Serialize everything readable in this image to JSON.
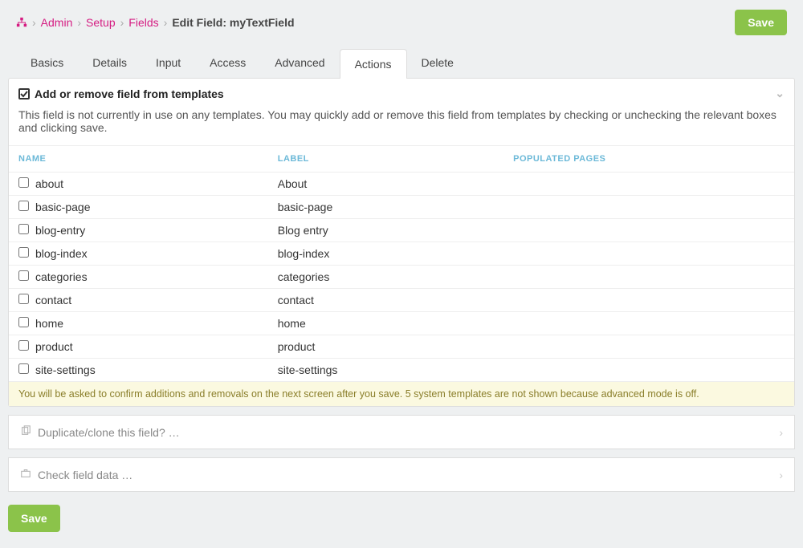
{
  "breadcrumb": {
    "items": [
      "Admin",
      "Setup",
      "Fields"
    ],
    "current": "Edit Field: myTextField"
  },
  "buttons": {
    "save": "Save"
  },
  "tabs": [
    "Basics",
    "Details",
    "Input",
    "Access",
    "Advanced",
    "Actions",
    "Delete"
  ],
  "active_tab": "Actions",
  "section": {
    "title": "Add or remove field from templates",
    "desc": "This field is not currently in use on any templates. You may quickly add or remove this field from templates by checking or unchecking the relevant boxes and clicking save.",
    "columns": {
      "name": "NAME",
      "label": "LABEL",
      "populated": "POPULATED PAGES"
    },
    "rows": [
      {
        "name": "about",
        "label": "About",
        "pop": ""
      },
      {
        "name": "basic-page",
        "label": "basic-page",
        "pop": ""
      },
      {
        "name": "blog-entry",
        "label": "Blog entry",
        "pop": ""
      },
      {
        "name": "blog-index",
        "label": "blog-index",
        "pop": ""
      },
      {
        "name": "categories",
        "label": "categories",
        "pop": ""
      },
      {
        "name": "contact",
        "label": "contact",
        "pop": ""
      },
      {
        "name": "home",
        "label": "home",
        "pop": ""
      },
      {
        "name": "product",
        "label": "product",
        "pop": ""
      },
      {
        "name": "site-settings",
        "label": "site-settings",
        "pop": ""
      }
    ],
    "note": "You will be asked to confirm additions and removals on the next screen after you save. 5 system templates are not shown because advanced mode is off."
  },
  "collapsed": {
    "duplicate": "Duplicate/clone this field? …",
    "checkdata": "Check field data …"
  }
}
